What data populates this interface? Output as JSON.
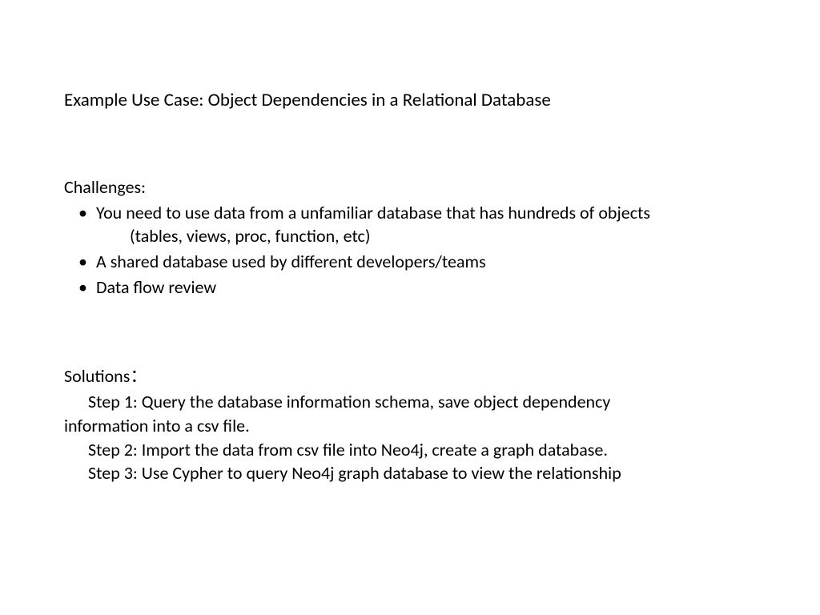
{
  "title": "Example Use Case: Object Dependencies in a Relational Database",
  "challenges": {
    "heading": "Challenges:",
    "items": [
      {
        "line1": "You need to use data from a unfamiliar database that has hundreds of objects",
        "line2": "(tables, views, proc, function, etc)"
      },
      {
        "line1": "A shared database used by different developers/teams"
      },
      {
        "line1": "Data flow review"
      }
    ]
  },
  "solutions": {
    "heading": "Solutions：",
    "steps": [
      {
        "line1": "Step 1: Query the database information schema, save object dependency",
        "line2": "information into a csv file."
      },
      {
        "line1": "Step 2: Import the data from csv file into Neo4j, create a graph database."
      },
      {
        "line1": "Step 3: Use Cypher to query Neo4j graph database to view the relationship"
      }
    ]
  }
}
